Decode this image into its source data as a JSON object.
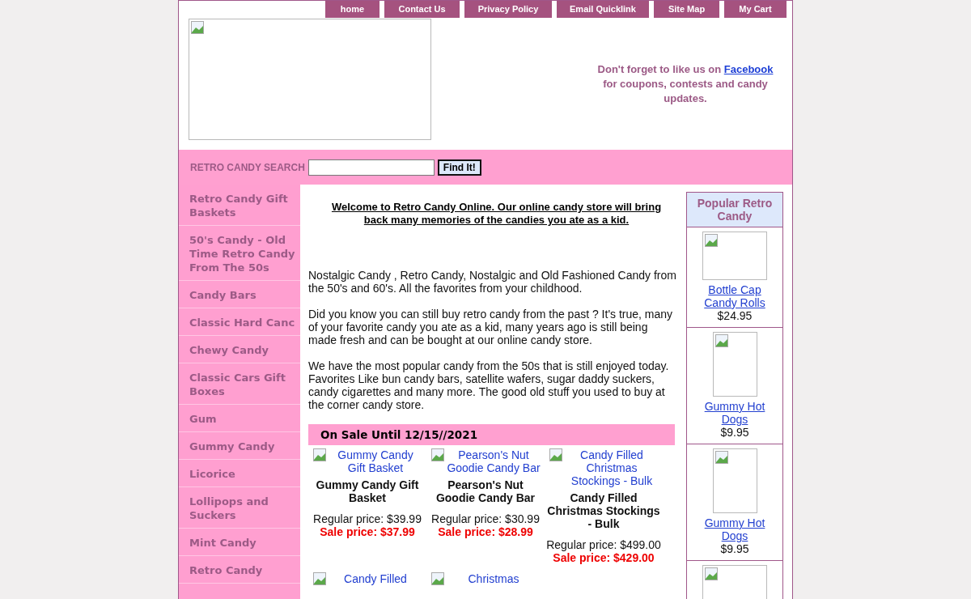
{
  "nav": [
    "home",
    "Contact Us",
    "Privacy Policy",
    "Email Quicklink",
    "Site Map",
    "My Cart"
  ],
  "facebook_note": {
    "before": "Don't forget to like us on ",
    "link": "Facebook",
    "after": " for coupons, contests and candy updates."
  },
  "search": {
    "label": "RETRO CANDY SEARCH",
    "button": "Find It!"
  },
  "sidebar": [
    "Retro Candy Gift Baskets",
    "50's Candy - Old Time Retro Candy From The 50s",
    "Candy Bars",
    "Classic Hard Canc",
    "Chewy Candy",
    "Classic Cars Gift Boxes",
    "Gum",
    "Gummy Candy",
    "Licorice",
    "Lollipops and Suckers",
    "Mint Candy",
    "Retro Candy"
  ],
  "welcome": "Welcome to Retro Candy Online. Our online candy store will bring back many memories of the candies you ate as a kid.",
  "paragraphs": [
    "Nostalgic Candy , Retro Candy, Nostalgic and Old Fashioned Candy from the 50's and 60's. All the favorites from your childhood.",
    "Did you know you can still buy retro candy from the past ? It's true, many of your favorite candy you ate as a kid, many years ago is still being made fresh and can be bought at our online candy store.",
    "We have the most popular candy from the 50s that is still enjoyed today. Favorites Like bun candy bars, satellite wafers, sugar daddy suckers, candy cigarettes and many more. The good old stuff you used to buy at the corner candy store."
  ],
  "sale": {
    "title": "On Sale Until 12/15//2021",
    "products": [
      {
        "alt": "Gummy Candy Gift Basket",
        "name": "Gummy Candy Gift Basket",
        "regular": "Regular price: $39.99",
        "price": "Sale price: $37.99"
      },
      {
        "alt": "Pearson's Nut Goodie Candy Bar",
        "name": "Pearson's Nut Goodie Candy Bar",
        "regular": "Regular price: $30.99",
        "price": "Sale price: $28.99"
      },
      {
        "alt": "Candy Filled Christmas Stockings - Bulk",
        "name": "Candy Filled Christmas Stockings - Bulk",
        "regular": "Regular price: $499.00",
        "price": "Sale price: $429.00"
      },
      {
        "alt": "Candy Filled"
      },
      {
        "alt": "Christmas"
      }
    ]
  },
  "popular": {
    "title": "Popular Retro Candy",
    "items": [
      {
        "name": "Bottle Cap Candy Rolls",
        "price": "$24.95",
        "wide": true
      },
      {
        "name": "Gummy Hot Dogs",
        "price": "$9.95",
        "wide": false
      },
      {
        "name": "Gummy Hot Dogs",
        "price": "$9.95",
        "wide": false
      },
      {
        "wide": true
      }
    ]
  }
}
